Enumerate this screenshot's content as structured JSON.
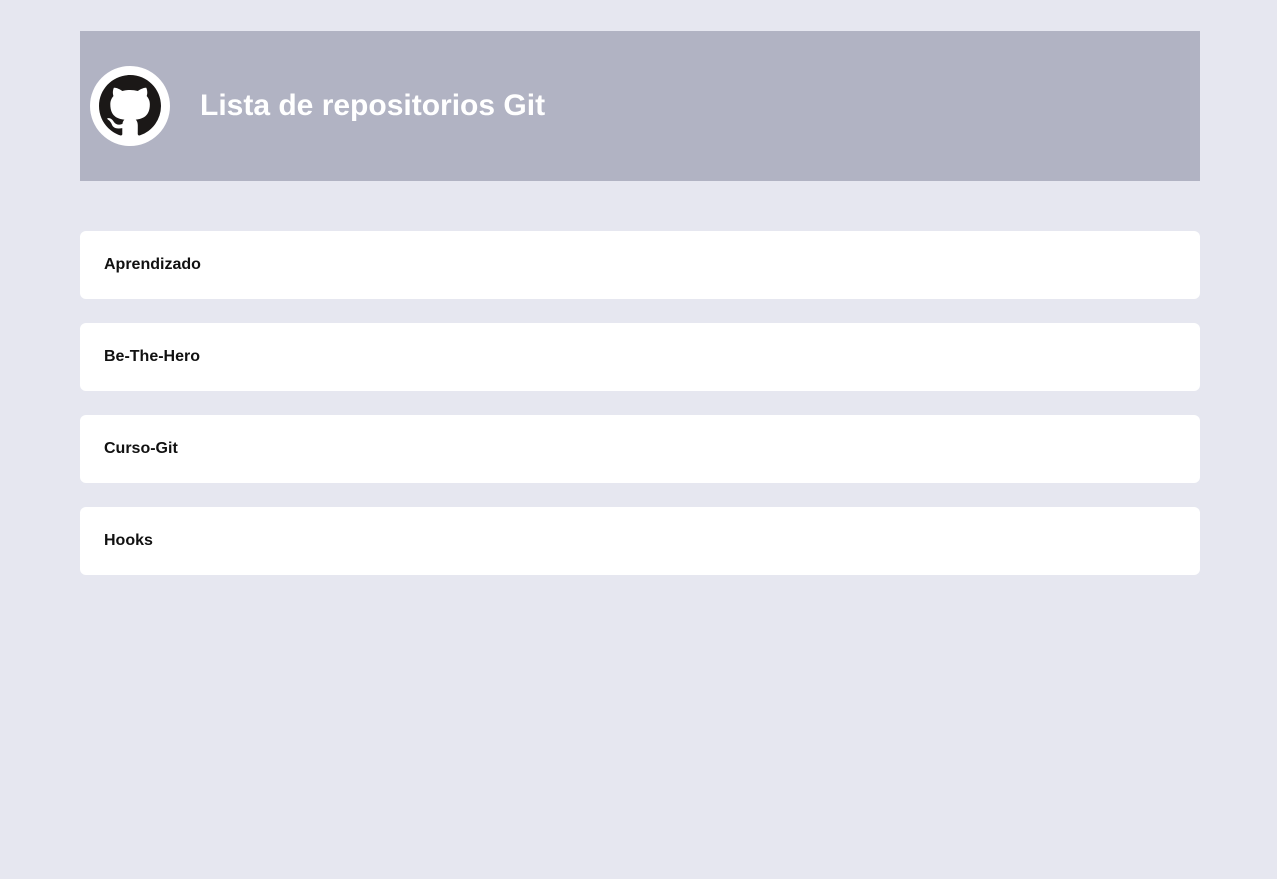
{
  "header": {
    "title": "Lista de repositorios Git",
    "logo_icon": "github-octocat-icon",
    "background_color": "#b1b3c3",
    "title_color": "#ffffff"
  },
  "page": {
    "background_color": "#e6e7f0"
  },
  "repositories": [
    {
      "name": "Aprendizado"
    },
    {
      "name": "Be-The-Hero"
    },
    {
      "name": "Curso-Git"
    },
    {
      "name": "Hooks"
    }
  ]
}
